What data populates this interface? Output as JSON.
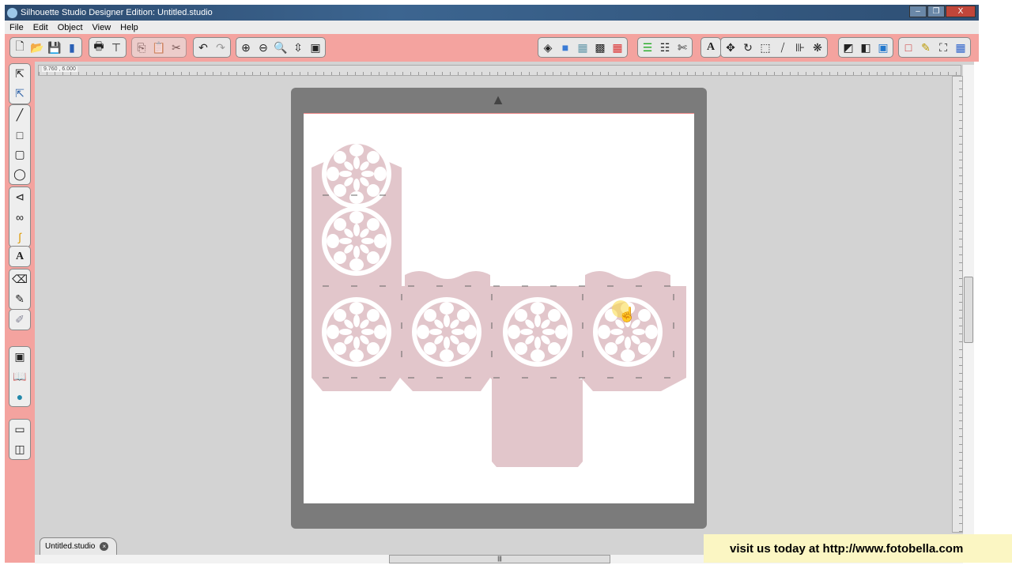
{
  "window": {
    "title": "Silhouette Studio Designer Edition: Untitled.studio",
    "minimize": "–",
    "maximize": "❐",
    "close": "X"
  },
  "menu": [
    "File",
    "Edit",
    "Object",
    "View",
    "Help"
  ],
  "toolbar": {
    "file": [
      "new-icon",
      "open-icon",
      "save-icon",
      "save-to-sd-icon"
    ],
    "print": [
      "print-icon",
      "print-cut-icon"
    ],
    "clipboard": [
      "copy-icon",
      "paste-icon",
      "cut-icon"
    ],
    "history": [
      "undo-icon",
      "redo-icon"
    ],
    "zoom": [
      "zoom-in-icon",
      "zoom-out-icon",
      "zoom-select-icon",
      "pan-icon",
      "fit-page-icon"
    ],
    "right": [
      "fill-color-icon",
      "gradient-icon",
      "pattern-icon",
      "line-style-icon",
      "line-color-icon",
      "line-settings-icon",
      "line-weight-icon",
      "cut-settings-icon",
      "text-style-icon",
      "transform-icon",
      "rotate-icon",
      "scale-icon",
      "shear-icon",
      "align-icon",
      "replicate-icon",
      "design-store-icon",
      "page-setup-icon",
      "registration-icon",
      "offset-icon",
      "trace-icon",
      "grid-icon",
      "library-icon"
    ]
  },
  "ruler": {
    "coords": "9.760 , 6.000"
  },
  "tools": [
    "select-icon",
    "point-edit-icon",
    "line-icon",
    "rectangle-icon",
    "rounded-rectangle-icon",
    "ellipse-icon",
    "polygon-icon",
    "curve-icon",
    "freehand-icon",
    "text-icon",
    "eraser-icon",
    "knife-icon",
    "sketch-icon",
    "cut-icon",
    "library-icon",
    "store-icon",
    "single-view-icon",
    "split-view-icon"
  ],
  "tab": {
    "label": "Untitled.studio",
    "close": "×"
  },
  "banner": "visit us today at http://www.fotobella.com",
  "colors": {
    "toolbar": "#f4a39f",
    "design": "#e2c6cb",
    "mat": "#7b7b7b",
    "banner": "#fbf6c3"
  }
}
